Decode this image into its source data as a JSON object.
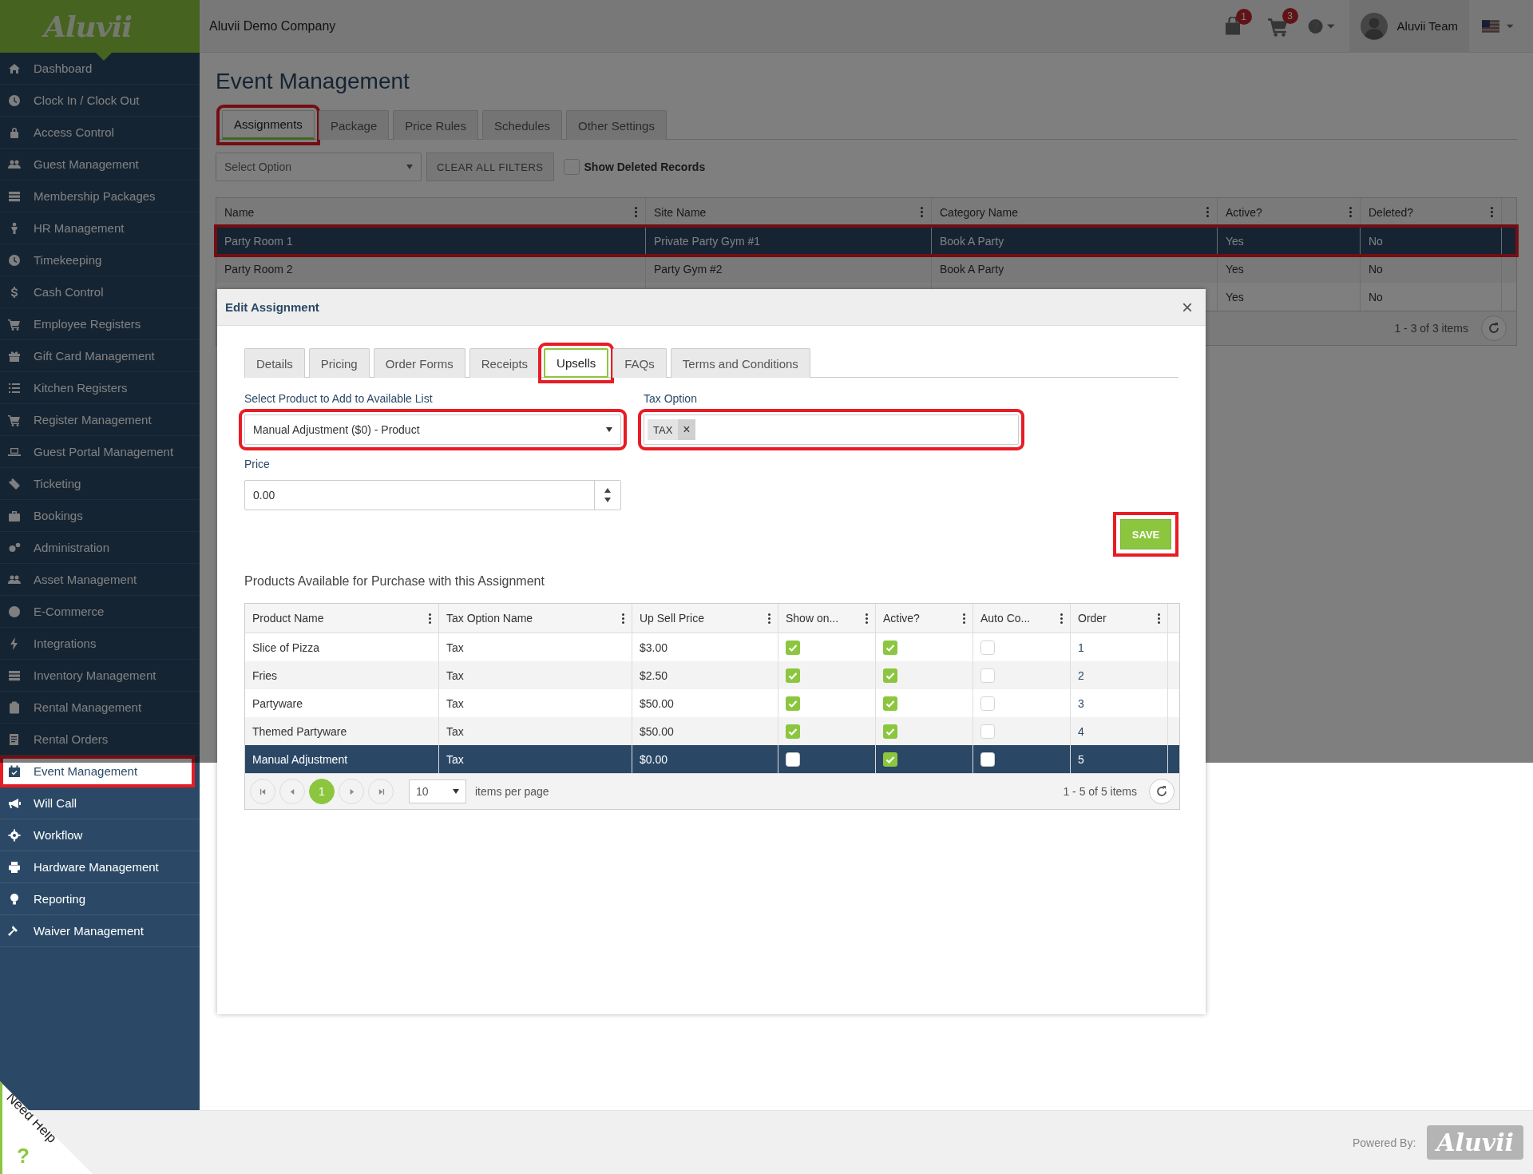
{
  "sidebar": {
    "logo": "Aluvii",
    "items": [
      {
        "label": "Dashboard",
        "selected": false,
        "highlighted": false
      },
      {
        "label": "Clock In / Clock Out",
        "selected": false,
        "highlighted": false
      },
      {
        "label": "Access Control",
        "selected": false,
        "highlighted": false
      },
      {
        "label": "Guest Management",
        "selected": false,
        "highlighted": false
      },
      {
        "label": "Membership Packages",
        "selected": false,
        "highlighted": false
      },
      {
        "label": "HR Management",
        "selected": false,
        "highlighted": false
      },
      {
        "label": "Timekeeping",
        "selected": false,
        "highlighted": false
      },
      {
        "label": "Cash Control",
        "selected": false,
        "highlighted": false
      },
      {
        "label": "Employee Registers",
        "selected": false,
        "highlighted": false
      },
      {
        "label": "Gift Card Management",
        "selected": false,
        "highlighted": false
      },
      {
        "label": "Kitchen Registers",
        "selected": false,
        "highlighted": false
      },
      {
        "label": "Register Management",
        "selected": false,
        "highlighted": false
      },
      {
        "label": "Guest Portal Management",
        "selected": false,
        "highlighted": false
      },
      {
        "label": "Ticketing",
        "selected": false,
        "highlighted": false
      },
      {
        "label": "Bookings",
        "selected": false,
        "highlighted": false
      },
      {
        "label": "Administration",
        "selected": false,
        "highlighted": false
      },
      {
        "label": "Asset Management",
        "selected": false,
        "highlighted": false
      },
      {
        "label": "E-Commerce",
        "selected": false,
        "highlighted": false
      },
      {
        "label": "Integrations",
        "selected": false,
        "highlighted": false
      },
      {
        "label": "Inventory Management",
        "selected": false,
        "highlighted": false
      },
      {
        "label": "Rental Management",
        "selected": false,
        "highlighted": false
      },
      {
        "label": "Rental Orders",
        "selected": false,
        "highlighted": false
      },
      {
        "label": "Event Management",
        "selected": true,
        "highlighted": true
      },
      {
        "label": "Will Call",
        "selected": false,
        "highlighted": false
      },
      {
        "label": "Workflow",
        "selected": false,
        "highlighted": false
      },
      {
        "label": "Hardware Management",
        "selected": false,
        "highlighted": false
      },
      {
        "label": "Reporting",
        "selected": false,
        "highlighted": false
      },
      {
        "label": "Waiver Management",
        "selected": false,
        "highlighted": false
      }
    ]
  },
  "top_bar": {
    "company": "Aluvii Demo Company",
    "bag_badge": "1",
    "cart_badge": "3",
    "user": "Aluvii Team"
  },
  "page": {
    "title": "Event Management",
    "tabs": [
      {
        "label": "Assignments",
        "selected": true,
        "highlighted": true
      },
      {
        "label": "Package",
        "selected": false,
        "highlighted": false
      },
      {
        "label": "Price Rules",
        "selected": false,
        "highlighted": false
      },
      {
        "label": "Schedules",
        "selected": false,
        "highlighted": false
      },
      {
        "label": "Other Settings",
        "selected": false,
        "highlighted": false
      }
    ],
    "filter": {
      "placeholder": "Select Option",
      "clear_button": "CLEAR ALL FILTERS",
      "show_deleted": {
        "label": "Show Deleted Records",
        "checked": false
      }
    },
    "grid": {
      "columns": [
        "Name",
        "Site Name",
        "Category Name",
        "Active?",
        "Deleted?"
      ],
      "rows": [
        {
          "name": "Party Room 1",
          "site": "Private Party Gym #1",
          "category": "Book A Party",
          "active": "Yes",
          "deleted": "No",
          "selected": true,
          "highlighted": true
        },
        {
          "name": "Party Room 2",
          "site": "Party Gym #2",
          "category": "Book A Party",
          "active": "Yes",
          "deleted": "No",
          "selected": false,
          "highlighted": false
        },
        {
          "active": "Yes",
          "deleted": "No",
          "selected": false,
          "highlighted": false
        }
      ],
      "summary": "1 - 3 of 3 items"
    }
  },
  "modal": {
    "title": "Edit Assignment",
    "close": "×",
    "tabs": [
      {
        "label": "Details",
        "selected": false,
        "highlighted": false
      },
      {
        "label": "Pricing",
        "selected": false,
        "highlighted": false
      },
      {
        "label": "Order Forms",
        "selected": false,
        "highlighted": false
      },
      {
        "label": "Receipts",
        "selected": false,
        "highlighted": false
      },
      {
        "label": "Upsells",
        "selected": true,
        "highlighted": true
      },
      {
        "label": "FAQs",
        "selected": false,
        "highlighted": false
      },
      {
        "label": "Terms and Conditions",
        "selected": false,
        "highlighted": false
      }
    ],
    "product_select": {
      "label": "Select Product to Add to Available List",
      "value": "Manual Adjustment ($0) - Product",
      "highlighted": true
    },
    "tax_option": {
      "label": "Tax Option",
      "tag": "TAX",
      "remove": "×",
      "highlighted": true
    },
    "price": {
      "label": "Price",
      "value": "0.00"
    },
    "save_button": {
      "label": "SAVE",
      "highlighted": true
    },
    "products_heading": "Products Available for Purchase with this Assignment",
    "products": {
      "columns": [
        "Product Name",
        "Tax Option Name",
        "Up Sell Price",
        "Show on...",
        "Active?",
        "Auto Co...",
        "Order"
      ],
      "rows": [
        {
          "name": "Slice of Pizza",
          "tax": "Tax",
          "price": "$3.00",
          "show_on": true,
          "active": true,
          "auto_co": false,
          "order": "1",
          "selected": false
        },
        {
          "name": "Fries",
          "tax": "Tax",
          "price": "$2.50",
          "show_on": true,
          "active": true,
          "auto_co": false,
          "order": "2",
          "selected": false
        },
        {
          "name": "Partyware",
          "tax": "Tax",
          "price": "$50.00",
          "show_on": true,
          "active": true,
          "auto_co": false,
          "order": "3",
          "selected": false
        },
        {
          "name": "Themed Partyware",
          "tax": "Tax",
          "price": "$50.00",
          "show_on": true,
          "active": true,
          "auto_co": false,
          "order": "4",
          "selected": false
        },
        {
          "name": "Manual Adjustment",
          "tax": "Tax",
          "price": "$0.00",
          "show_on": false,
          "active": true,
          "auto_co": false,
          "order": "5",
          "selected": true
        }
      ],
      "pages": [
        {
          "label": "1",
          "selected": true
        }
      ],
      "page_size": "10",
      "page_size_label": "items per page",
      "summary": "1 - 5 of 5 items"
    }
  },
  "help": {
    "label": "Need Help",
    "mark": "?"
  },
  "footer": {
    "powered_by": "Powered By:",
    "logo": "Aluvii"
  }
}
